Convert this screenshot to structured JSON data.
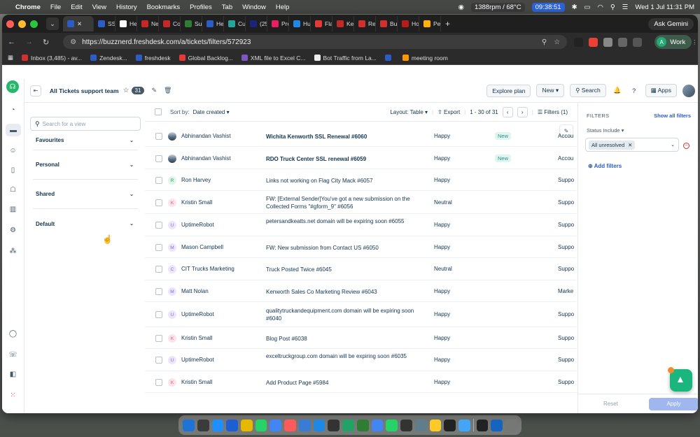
{
  "menubar": {
    "app": "Chrome",
    "menus": [
      "File",
      "Edit",
      "View",
      "History",
      "Bookmarks",
      "Profiles",
      "Tab",
      "Window",
      "Help"
    ],
    "rpm": "1388rpm / 68°C",
    "timer": "09:38:51",
    "datetime": "Wed 1 Jul  11:31 PM"
  },
  "browser": {
    "tabs": [
      {
        "label": "SSI",
        "color": "#2c5cc5"
      },
      {
        "label": "Hel",
        "color": "#ffffff"
      },
      {
        "label": "Ne",
        "color": "#c62828"
      },
      {
        "label": "Co",
        "color": "#c62828"
      },
      {
        "label": "Su",
        "color": "#2e7d32"
      },
      {
        "label": "Hel",
        "color": "#2c5cc5"
      },
      {
        "label": "Cu",
        "color": "#26a69a"
      },
      {
        "label": "(25",
        "color": "#1a237e"
      },
      {
        "label": "Pro",
        "color": "#e91e63"
      },
      {
        "label": "Hul",
        "color": "#1e88e5"
      },
      {
        "label": "Fla",
        "color": "#e53935"
      },
      {
        "label": "Ker",
        "color": "#c62828"
      },
      {
        "label": "Re",
        "color": "#d32f2f"
      },
      {
        "label": "Bu",
        "color": "#d32f2f"
      },
      {
        "label": "Ho",
        "color": "#b71c1c"
      },
      {
        "label": "Pet",
        "color": "#ffb300"
      }
    ],
    "active_tab_color": "#2c5cc5",
    "ask_gemini": "Ask Gemini",
    "url": "https://buzznerd.freshdesk.com/a/tickets/filters/572923",
    "profile": "Work",
    "profile_initial": "A",
    "bookmarks": [
      {
        "label": "Inbox (3,485) - av...",
        "color": "#d32f2f"
      },
      {
        "label": "Zendesk...",
        "color": "#2c5cc5"
      },
      {
        "label": "freshdesk",
        "color": "#2c5cc5"
      },
      {
        "label": "Global Backlog...",
        "color": "#e53935"
      },
      {
        "label": "XML file to Excel C...",
        "color": "#7e57c2"
      },
      {
        "label": "Bot Traffic from La...",
        "color": "#eeeeee"
      },
      {
        "label": "",
        "color": "#2c5cc5"
      },
      {
        "label": "meeting room",
        "color": "#ff9800"
      }
    ]
  },
  "topbar": {
    "view_name": "All Tickets support team",
    "count": "31",
    "explore": "Explore plan",
    "new": "New",
    "search": "Search",
    "apps": "Apps"
  },
  "views": {
    "search_placeholder": "Search for a view",
    "sections": [
      "Favourites",
      "Personal",
      "Shared",
      "Default"
    ]
  },
  "list": {
    "sort_label": "Sort by:",
    "sort_value": "Date created",
    "layout": "Layout: Table",
    "export": "Export",
    "range": "1 - 30 of 31",
    "filters_btn": "Filters (1)",
    "rows": [
      {
        "avatar": "img",
        "initial": "",
        "requester": "Abhinandan Vashist",
        "subject": "Wichita Kenworth SSL Renewal #6060",
        "bold": true,
        "sentiment": "Happy",
        "badge": "New",
        "group": "Accou"
      },
      {
        "avatar": "img",
        "initial": "",
        "requester": "Abhinandan Vashist",
        "subject": "RDO Truck Center SSL renewal #6059",
        "bold": true,
        "sentiment": "Happy",
        "badge": "New",
        "group": "Accou"
      },
      {
        "avatar": "green",
        "initial": "R",
        "requester": "Ron Harvey",
        "subject": "Links not working on Flag City Mack #6057",
        "bold": false,
        "sentiment": "Happy",
        "badge": "",
        "group": "Suppo"
      },
      {
        "avatar": "pink",
        "initial": "K",
        "requester": "Kristin Small",
        "subject": "FW: [External Sender]You've got a new submission on the Collected Forms \"#gform_9\" #6056",
        "bold": false,
        "sentiment": "Neutral",
        "badge": "",
        "group": "Suppo"
      },
      {
        "avatar": "purple",
        "initial": "U",
        "requester": "UptimeRobot",
        "subject": "petersandkeatts.net domain will be expiring soon #6055",
        "bold": false,
        "sentiment": "Happy",
        "badge": "",
        "group": "Suppo"
      },
      {
        "avatar": "purple",
        "initial": "M",
        "requester": "Mason Campbell",
        "subject": "FW: New submission from Contact US #6050",
        "bold": false,
        "sentiment": "Happy",
        "badge": "",
        "group": "Suppo"
      },
      {
        "avatar": "purple",
        "initial": "C",
        "requester": "CIT Trucks Marketing",
        "subject": "Truck Posted Twice #6045",
        "bold": false,
        "sentiment": "Neutral",
        "badge": "",
        "group": "Suppo"
      },
      {
        "avatar": "purple",
        "initial": "M",
        "requester": "Matt Nolan",
        "subject": "Kenworth Sales Co Marketing Review #6043",
        "bold": false,
        "sentiment": "Happy",
        "badge": "",
        "group": "Marke"
      },
      {
        "avatar": "purple",
        "initial": "U",
        "requester": "UptimeRobot",
        "subject": "qualitytruckandequipment.com domain will be expiring soon #6040",
        "bold": false,
        "sentiment": "Happy",
        "badge": "",
        "group": "Suppo"
      },
      {
        "avatar": "pink",
        "initial": "K",
        "requester": "Kristin Small",
        "subject": "Blog Post #6038",
        "bold": false,
        "sentiment": "Happy",
        "badge": "",
        "group": "Suppo"
      },
      {
        "avatar": "purple",
        "initial": "U",
        "requester": "UptimeRobot",
        "subject": "exceltruckgroup.com domain will be expiring soon #6035",
        "bold": false,
        "sentiment": "Happy",
        "badge": "",
        "group": "Suppo"
      },
      {
        "avatar": "pink",
        "initial": "K",
        "requester": "Kristin Small",
        "subject": "Add Product Page #5984",
        "bold": false,
        "sentiment": "Happy",
        "badge": "",
        "group": "Suppo"
      }
    ]
  },
  "filters": {
    "title": "FILTERS",
    "show_all": "Show all filters",
    "status_label": "Status Include",
    "chip": "All unresolved",
    "add": "Add filters",
    "reset": "Reset",
    "apply": "Apply"
  },
  "avatar_colors": {
    "green": {
      "bg": "#e0f5e8",
      "fg": "#2e9e5b"
    },
    "pink": {
      "bg": "#fde4e8",
      "fg": "#d4607a"
    },
    "purple": {
      "bg": "#ece6fa",
      "fg": "#8a6ad8"
    }
  },
  "dock_colors": [
    "#1e73d6",
    "#3b3b3b",
    "#1f8fff",
    "#1d5fd1",
    "#e6b800",
    "#25d366",
    "#4285f4",
    "#ff5a5a",
    "#3a7bd5",
    "#1e88e5",
    "#333",
    "#21a366",
    "#2e7d32",
    "#4285f4",
    "#25d366",
    "#333",
    "#607d8b",
    "#ffca28",
    "#222",
    "#42a5f5",
    "#222",
    "#1565c0",
    "#777"
  ]
}
